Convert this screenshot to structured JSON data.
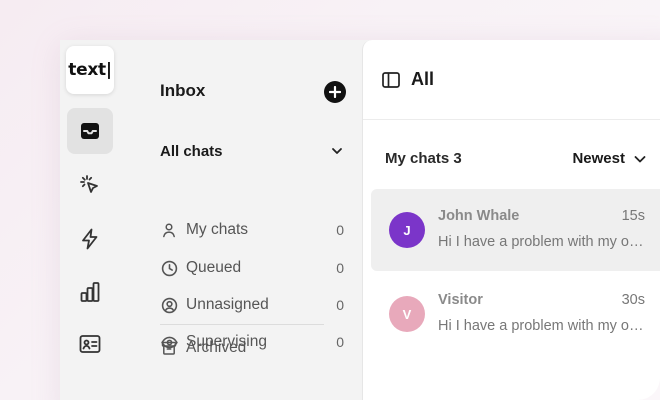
{
  "app": {
    "logo_text": "text|"
  },
  "rail": {
    "items": [
      {
        "name": "inbox",
        "icon": "inbox-icon",
        "active": true
      },
      {
        "name": "clicks",
        "icon": "cursor-click-icon",
        "active": false
      },
      {
        "name": "automations",
        "icon": "lightning-icon",
        "active": false
      },
      {
        "name": "reports",
        "icon": "bar-chart-icon",
        "active": false
      },
      {
        "name": "contacts",
        "icon": "contact-card-icon",
        "active": false
      }
    ]
  },
  "inbox": {
    "title": "Inbox",
    "add_icon": "plus-circle-icon",
    "section_title": "All chats",
    "items": [
      {
        "label": "My chats",
        "count": "0",
        "icon": "user-icon"
      },
      {
        "label": "Queued",
        "count": "0",
        "icon": "clock-icon"
      },
      {
        "label": "Unnasigned",
        "count": "0",
        "icon": "user-circle-icon"
      },
      {
        "label": "Supervising",
        "count": "0",
        "icon": "eye-icon"
      }
    ],
    "archived": {
      "label": "Archived",
      "icon": "archive-icon"
    }
  },
  "chats": {
    "header_title": "All",
    "list_title": "My chats 3",
    "sort_label": "Newest",
    "items": [
      {
        "initial": "J",
        "name": "John Whale",
        "time": "15s",
        "preview": "Hi I have a problem with my order",
        "avatar_color": "#7b35c9",
        "selected": true
      },
      {
        "initial": "V",
        "name": "Visitor",
        "time": "30s",
        "preview": "Hi I have a problem with my order",
        "avatar_color": "#e8a9bb",
        "selected": false
      }
    ]
  },
  "colors": {
    "accent": "#111111",
    "background": "#f3f3f3",
    "selected_row": "#efefef"
  }
}
